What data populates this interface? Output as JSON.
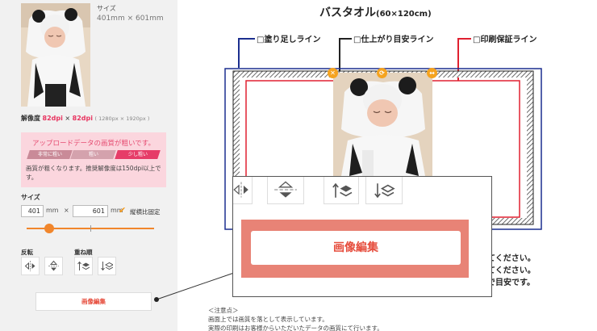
{
  "left_panel": {
    "size_info": {
      "label": "サイズ",
      "value": "401mm × 601mm"
    },
    "resolution": {
      "label": "解像度",
      "value_x": "82dpi",
      "times": "×",
      "value_y": "82dpi",
      "pixels": "( 1280px × 1920px )"
    },
    "warning": {
      "title": "アップロードデータの画質が粗いです。",
      "scale": [
        {
          "label": "非常に粗い",
          "color": "#c98a98"
        },
        {
          "label": "粗い",
          "color": "#d4a2ad"
        },
        {
          "label": "少し粗い",
          "color": "#e63c68"
        }
      ],
      "text": "画質が粗くなります。推奨解像度は150dpi以上です。"
    },
    "size": {
      "label": "サイズ",
      "width_value": "401",
      "height_value": "601",
      "unit": "mm",
      "times": "×",
      "lock_label": "縦横比固定",
      "lock_checked": true
    },
    "slider": {
      "value": 0.18
    },
    "flip_label": "反転",
    "order_label": "重ね順",
    "flip_buttons": [
      {
        "name": "flip-horizontal-icon"
      },
      {
        "name": "flip-vertical-icon"
      }
    ],
    "order_buttons": [
      {
        "name": "bring-forward-icon"
      },
      {
        "name": "send-backward-icon"
      }
    ],
    "edit_button": "画像編集"
  },
  "design": {
    "title": "バスタオル",
    "title_size": "(60×120cm)",
    "legend": {
      "bleed": "□塗り足しライン",
      "finish": "□仕上がり目安ライン",
      "safe": "□印刷保証ライン"
    },
    "colors": {
      "bleed": "#1c2f8f",
      "finish": "#222222",
      "safe": "#e02030",
      "handle": "#f5a31f"
    },
    "notes": [
      "てください。",
      "てください。",
      "で目安です。"
    ],
    "caution": {
      "title": "＜注意点＞",
      "lines": [
        "画面上では画質を落として表示しています。",
        "実際の印刷はお客様からいただいたデータの画質にて行います。"
      ]
    }
  },
  "zoom_popup": {
    "edit_button": "画像編集"
  }
}
